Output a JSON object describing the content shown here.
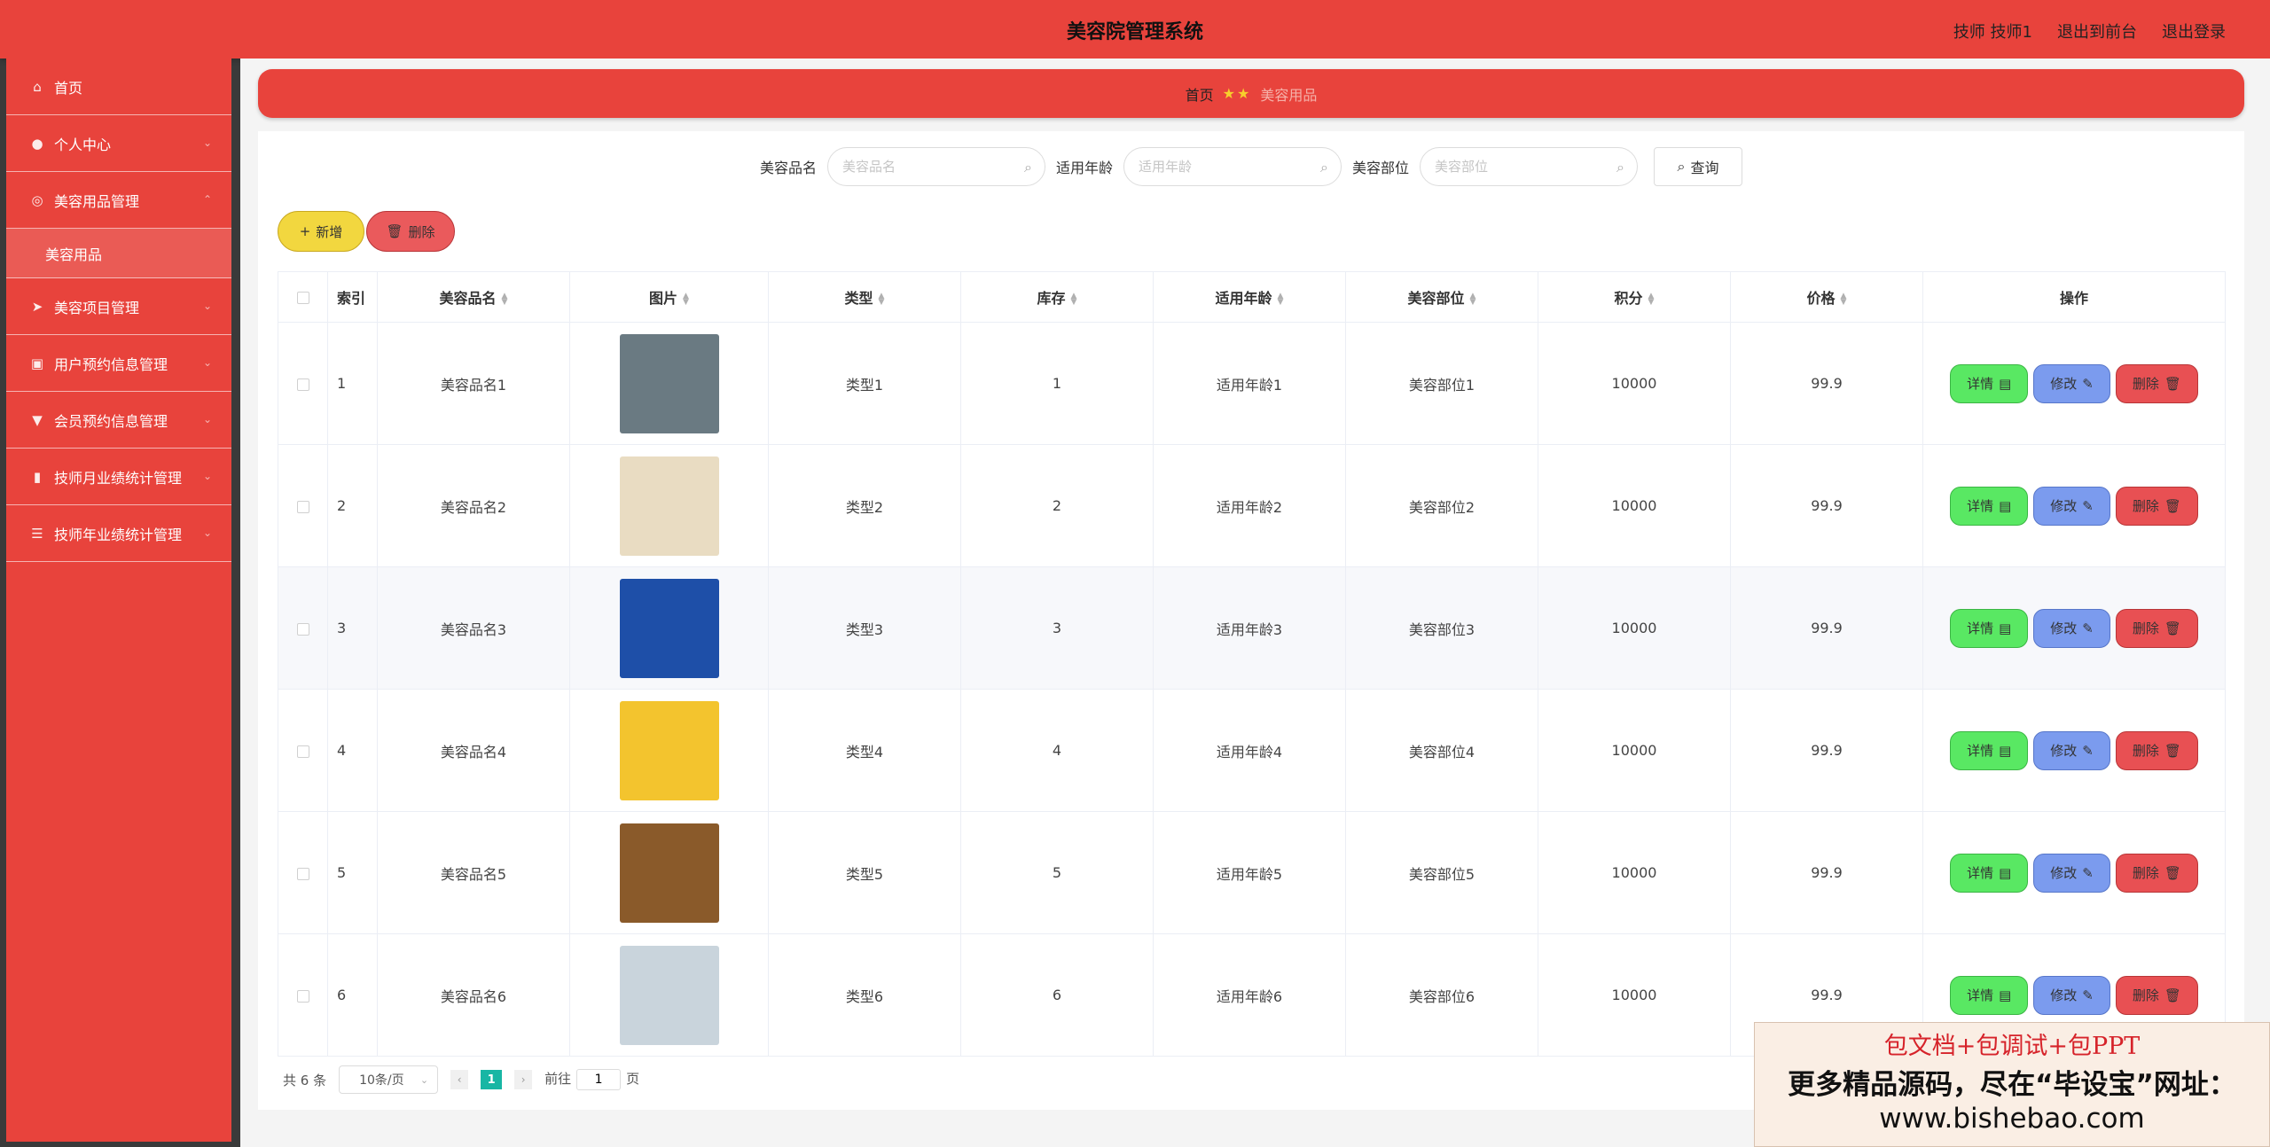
{
  "header": {
    "title": "美容院管理系统",
    "user": "技师 技师1",
    "frontend": "退出到前台",
    "logout": "退出登录"
  },
  "sidebar": {
    "home": "首页",
    "personal": "个人中心",
    "supplies_mgmt": "美容用品管理",
    "supplies": "美容用品",
    "projects_mgmt": "美容项目管理",
    "user_booking": "用户预约信息管理",
    "member_booking": "会员预约信息管理",
    "month_stats": "技师月业绩统计管理",
    "year_stats": "技师年业绩统计管理"
  },
  "breadcrumb": {
    "home": "首页",
    "current": "美容用品"
  },
  "search": {
    "name_label": "美容品名",
    "name_placeholder": "美容品名",
    "age_label": "适用年龄",
    "age_placeholder": "适用年龄",
    "part_label": "美容部位",
    "part_placeholder": "美容部位",
    "query": "查询"
  },
  "actions": {
    "add": "新增",
    "delete": "删除"
  },
  "table": {
    "headers": {
      "index": "索引",
      "name": "美容品名",
      "image": "图片",
      "type": "类型",
      "stock": "库存",
      "age": "适用年龄",
      "part": "美容部位",
      "points": "积分",
      "price": "价格",
      "ops": "操作"
    },
    "op_detail": "详情",
    "op_edit": "修改",
    "op_delete": "删除",
    "rows": [
      {
        "index": "1",
        "name": "美容品名1",
        "type": "类型1",
        "stock": "1",
        "age": "适用年龄1",
        "part": "美容部位1",
        "points": "10000",
        "price": "99.9",
        "img_color": "#6a7a82"
      },
      {
        "index": "2",
        "name": "美容品名2",
        "type": "类型2",
        "stock": "2",
        "age": "适用年龄2",
        "part": "美容部位2",
        "points": "10000",
        "price": "99.9",
        "img_color": "#e9dcc2"
      },
      {
        "index": "3",
        "name": "美容品名3",
        "type": "类型3",
        "stock": "3",
        "age": "适用年龄3",
        "part": "美容部位3",
        "points": "10000",
        "price": "99.9",
        "img_color": "#1e4fa8"
      },
      {
        "index": "4",
        "name": "美容品名4",
        "type": "类型4",
        "stock": "4",
        "age": "适用年龄4",
        "part": "美容部位4",
        "points": "10000",
        "price": "99.9",
        "img_color": "#f3c42e"
      },
      {
        "index": "5",
        "name": "美容品名5",
        "type": "类型5",
        "stock": "5",
        "age": "适用年龄5",
        "part": "美容部位5",
        "points": "10000",
        "price": "99.9",
        "img_color": "#8a5a2a"
      },
      {
        "index": "6",
        "name": "美容品名6",
        "type": "类型6",
        "stock": "6",
        "age": "适用年龄6",
        "part": "美容部位6",
        "points": "10000",
        "price": "99.9",
        "img_color": "#c9d4dc"
      }
    ]
  },
  "pagination": {
    "total": "共 6 条",
    "page_size": "10条/页",
    "current_page": "1",
    "goto_label": "前往",
    "goto_value": "1",
    "page_suffix": "页"
  },
  "promo": {
    "line1": "包文档+包调试+包PPT",
    "line2": "更多精品源码，尽在“毕设宝”网址：",
    "line3": "www.bishebao.com"
  }
}
